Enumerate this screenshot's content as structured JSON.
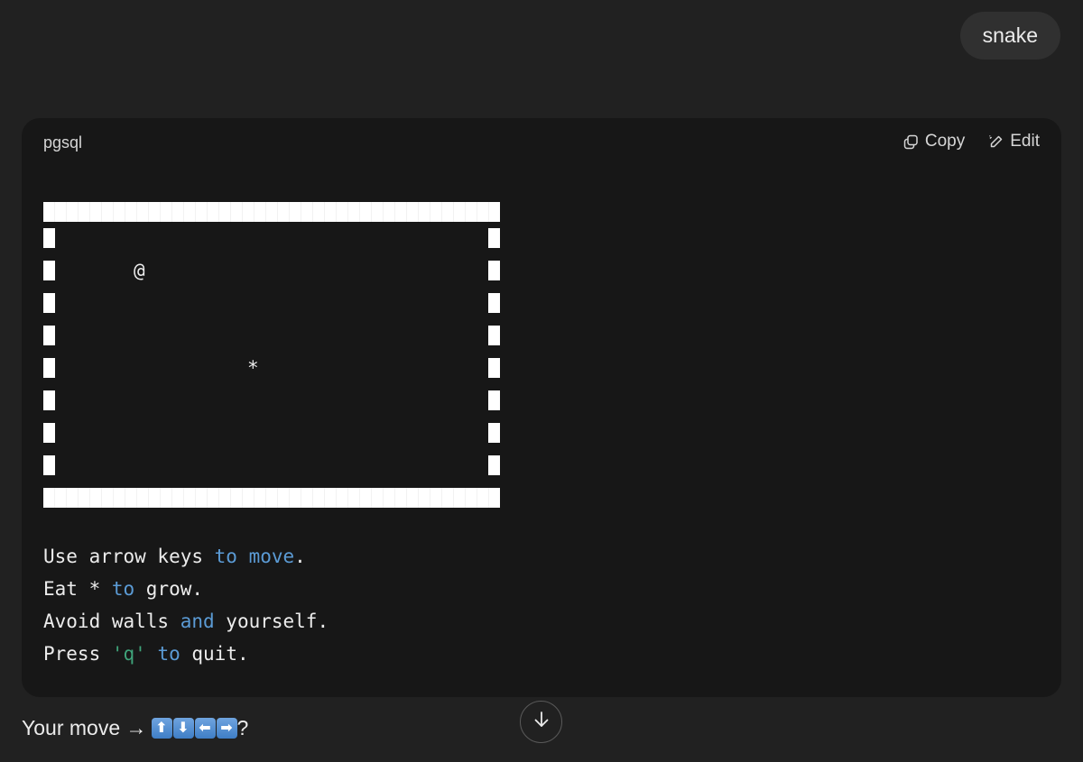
{
  "user_message": "snake",
  "code_block": {
    "language": "pgsql",
    "copy_label": "Copy",
    "edit_label": "Edit",
    "board": {
      "rows": 8,
      "snake_head": "@",
      "food": "*"
    },
    "instructions": [
      {
        "segments": [
          {
            "text": "Use arrow keys "
          },
          {
            "text": "to move",
            "kind": "kw"
          },
          {
            "text": "."
          }
        ]
      },
      {
        "segments": [
          {
            "text": "Eat * "
          },
          {
            "text": "to",
            "kind": "kw"
          },
          {
            "text": " grow."
          }
        ]
      },
      {
        "segments": [
          {
            "text": "Avoid walls "
          },
          {
            "text": "and",
            "kind": "kw"
          },
          {
            "text": " yourself."
          }
        ]
      },
      {
        "segments": [
          {
            "text": "Press "
          },
          {
            "text": "'q'",
            "kind": "str"
          },
          {
            "text": " "
          },
          {
            "text": "to",
            "kind": "kw"
          },
          {
            "text": " quit."
          }
        ]
      }
    ]
  },
  "reply": {
    "text": "Your move →",
    "keys": [
      "⬆",
      "⬇",
      "⬅",
      "➡"
    ],
    "suffix": "?"
  },
  "colors": {
    "background": "#212121",
    "code_background": "#171717",
    "keyword": "#5b9bd5",
    "string": "#3fa37a"
  },
  "icons": [
    "copy-icon",
    "edit-icon",
    "arrow-down-icon"
  ]
}
